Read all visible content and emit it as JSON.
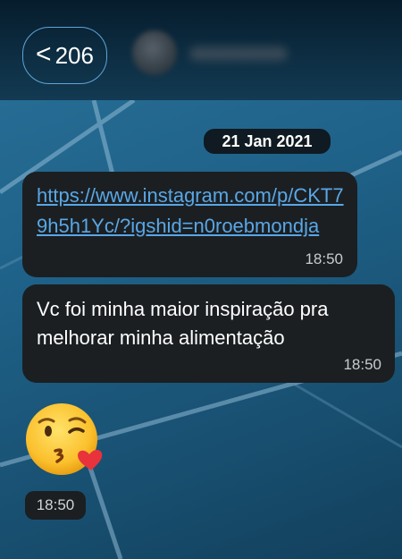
{
  "header": {
    "back_count": "206",
    "back_chevron": "<"
  },
  "date_chip": "21 Jan 2021",
  "messages": [
    {
      "type": "link",
      "text": "https://www.instagram.com/p/CKT79h5h1Yc/?igshid=n0roebmondja",
      "time": "18:50"
    },
    {
      "type": "text",
      "text": "Vc foi minha maior inspiração pra melhorar minha alimentação",
      "time": "18:50"
    },
    {
      "type": "emoji",
      "emoji": "face-blowing-kiss-icon",
      "time": "18:50"
    }
  ],
  "colors": {
    "header": "#0d2d42",
    "bubble": "#1b1f22",
    "link": "#59a7e6",
    "back_border": "#5fa4d6",
    "wallpaper": "#1f6289"
  }
}
